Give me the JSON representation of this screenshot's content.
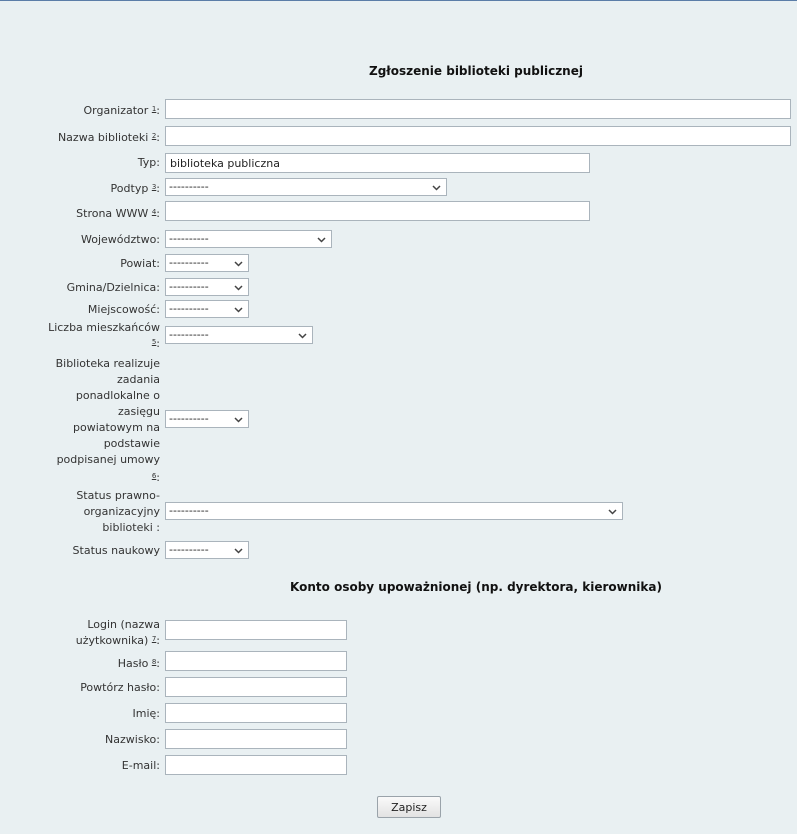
{
  "titles": {
    "library": "Zgłoszenie biblioteki publicznej",
    "account": "Konto osoby upoważnionej (np. dyrektora, kierownika)"
  },
  "library": {
    "organizator": {
      "label": "Organizator",
      "note": "1",
      "suffix": ":",
      "value": ""
    },
    "nazwa": {
      "label": "Nazwa biblioteki",
      "note": "2",
      "suffix": ":",
      "value": ""
    },
    "typ": {
      "label": "Typ:",
      "value": "biblioteka publiczna"
    },
    "podtyp": {
      "label": "Podtyp",
      "note": "3",
      "suffix": ":",
      "selected": "----------"
    },
    "www": {
      "label": "Strona WWW",
      "note": "4",
      "suffix": ":",
      "value": ""
    },
    "wojewodztwo": {
      "label": "Województwo:",
      "selected": "----------"
    },
    "powiat": {
      "label": "Powiat:",
      "selected": "----------"
    },
    "gmina": {
      "label": "Gmina/Dzielnica:",
      "selected": "----------"
    },
    "miejscowosc": {
      "label": "Miejscowość:",
      "selected": "----------"
    },
    "mieszkancy": {
      "line1": "Liczba mieszkańców",
      "note": "5",
      "suffix": ":",
      "selected": "----------"
    },
    "zadania": {
      "lines": [
        "Biblioteka realizuje",
        "zadania",
        "ponadlokalne o",
        "zasięgu",
        "powiatowym na",
        "podstawie",
        "podpisanej umowy"
      ],
      "note": "6",
      "suffix": ":",
      "selected": "----------"
    },
    "status_prawny": {
      "lines": [
        "Status prawno-",
        "organizacyjny",
        "biblioteki :"
      ],
      "selected": "----------"
    },
    "status_naukowy": {
      "label": "Status naukowy",
      "selected": "----------"
    }
  },
  "account": {
    "login": {
      "line1": "Login (nazwa",
      "line2": "użytkownika)",
      "note": "7",
      "suffix": ":",
      "value": ""
    },
    "haslo": {
      "label": "Hasło",
      "note": "8",
      "suffix": ":",
      "value": ""
    },
    "powtorz": {
      "label": "Powtórz hasło:",
      "value": ""
    },
    "imie": {
      "label": "Imię:",
      "value": ""
    },
    "nazwisko": {
      "label": "Nazwisko:",
      "value": ""
    },
    "email": {
      "label": "E-mail:",
      "value": ""
    }
  },
  "submit_label": "Zapisz",
  "colors": {
    "background": "#e9f0f2",
    "border": "#aab4bc"
  }
}
